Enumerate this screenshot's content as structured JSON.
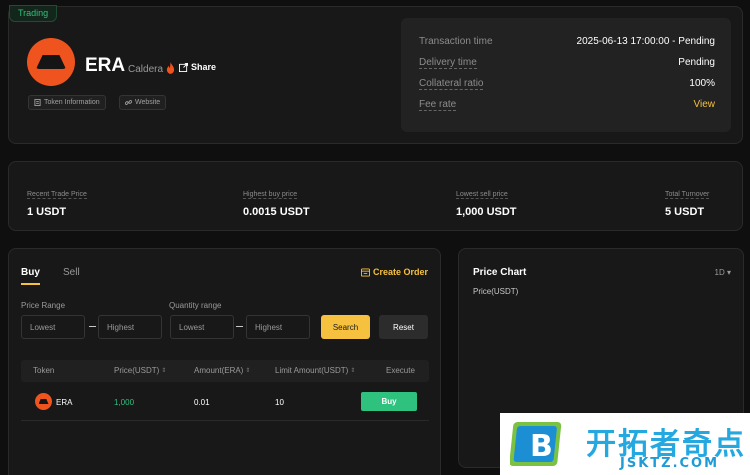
{
  "colors": {
    "background": "#0f0f10",
    "card": "#181818",
    "accent": "#f5c13e",
    "positive": "#2ec27e",
    "token_brand": "#f0541e",
    "tag_green": "#33c07a"
  },
  "header": {
    "status_tag": "Trading",
    "token": {
      "symbol": "ERA",
      "name": "Caldera",
      "logo_icon": "caldera-logo",
      "hot_icon": "flame-icon"
    },
    "share_label": "Share",
    "links": [
      {
        "label": "Token Information",
        "icon": "document-icon"
      },
      {
        "label": "Website",
        "icon": "link-icon"
      }
    ]
  },
  "transaction_info": {
    "rows": [
      {
        "label": "Transaction time",
        "value": "2025-06-13 17:00:00 - Pending"
      },
      {
        "label": "Delivery time",
        "value": "Pending"
      },
      {
        "label": "Collateral ratio",
        "value": "100%"
      },
      {
        "label": "Fee rate",
        "value": "View"
      }
    ]
  },
  "stats": [
    {
      "label": "Recent Trade Price",
      "value": "1 USDT"
    },
    {
      "label": "Highest buy price",
      "value": "0.0015 USDT"
    },
    {
      "label": "Lowest sell price",
      "value": "1,000 USDT"
    },
    {
      "label": "Total Turnover",
      "value": "5 USDT"
    }
  ],
  "trade": {
    "tabs": [
      "Buy",
      "Sell"
    ],
    "active_tab": "Buy",
    "create_order_label": "Create Order",
    "filters": {
      "price_range_label": "Price Range",
      "quantity_range_label": "Quantity range",
      "lowest_placeholder": "Lowest",
      "highest_placeholder": "Highest"
    },
    "search_label": "Search",
    "reset_label": "Reset",
    "columns": [
      "Token",
      "Price(USDT)",
      "Amount(ERA)",
      "Limit Amount(USDT)",
      "Execute"
    ],
    "rows": [
      {
        "token": "ERA",
        "price": "1,000",
        "amount": "0.01",
        "limit_amount": "10",
        "action": "Buy"
      }
    ]
  },
  "price_chart": {
    "title": "Price Chart",
    "unit_label": "Price(USDT)",
    "range": "1D"
  },
  "watermark": {
    "title": "开拓者奇点",
    "subtitle": "JSKTZ.COM",
    "logo_letter": "B"
  }
}
